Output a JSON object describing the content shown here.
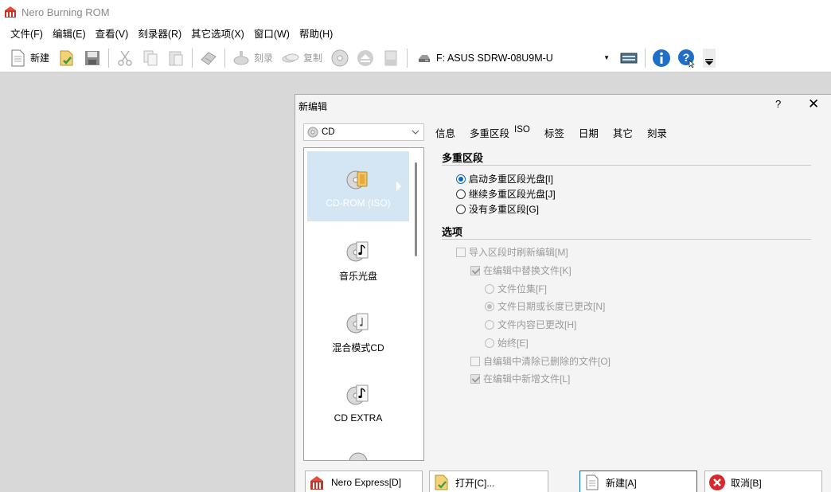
{
  "window": {
    "title": "Nero Burning ROM"
  },
  "menu": [
    {
      "label": "文件(F)"
    },
    {
      "label": "编辑(E)"
    },
    {
      "label": "查看(V)"
    },
    {
      "label": "刻录器(R)"
    },
    {
      "label": "其它选项(X)"
    },
    {
      "label": "窗口(W)"
    },
    {
      "label": "帮助(H)"
    }
  ],
  "toolbar": {
    "new_label": "新建",
    "burn_label": "刻录",
    "copy_label": "复制",
    "drive": "F: ASUS SDRW-08U9M-U"
  },
  "dialog": {
    "title": "新编辑",
    "help": "?",
    "close": "✕",
    "disc_type": "CD",
    "compilation_types": [
      {
        "label": "CD-ROM (ISO)",
        "icon": "cd-rom-iso-icon",
        "selected": true
      },
      {
        "label": "音乐光盘",
        "icon": "audio-cd-icon"
      },
      {
        "label": "混合模式CD",
        "icon": "mixed-mode-cd-icon"
      },
      {
        "label": "CD EXTRA",
        "icon": "cd-extra-icon"
      }
    ],
    "tabs": [
      "信息",
      "多重区段",
      "ISO",
      "标签",
      "日期",
      "其它",
      "刻录"
    ],
    "active_tab": "多重区段",
    "multisession_section": "多重区段",
    "multisession_options": [
      {
        "label": "启动多重区段光盘[I]",
        "checked": true
      },
      {
        "label": "继续多重区段光盘[J]",
        "checked": false
      },
      {
        "label": "没有多重区段[G]",
        "checked": false
      }
    ],
    "options_section": "选项",
    "options": {
      "refresh_on_import": "导入区段时刷新编辑[M]",
      "replace_files": "在编辑中替换文件[K]",
      "file_newer": "文件位集[F]",
      "date_size_changed": "文件日期或长度已更改[N]",
      "content_changed": "文件内容已更改[H]",
      "always": "始终[E]",
      "remove_deleted": "自编辑中清除已删除的文件[O]",
      "add_new": "在编辑中新增文件[L]"
    },
    "buttons": {
      "nero_express": "Nero Express[D]",
      "open": "打开[C]...",
      "new": "新建[A]",
      "cancel": "取消[B]"
    }
  },
  "colors": {
    "accent": "#0a68c4",
    "selection": "#d4e5f4",
    "workspace": "#d8d8d8"
  }
}
